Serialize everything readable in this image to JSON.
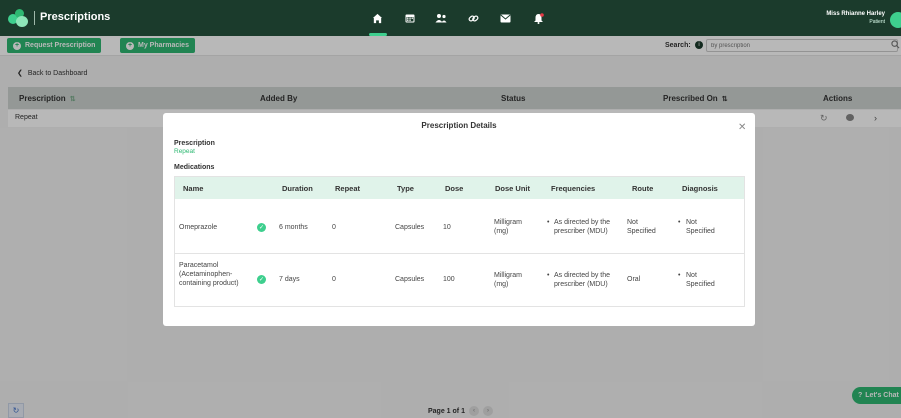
{
  "app": {
    "title": "Prescriptions"
  },
  "user": {
    "name": "Miss Rhianne Harley",
    "role": "Patient"
  },
  "nav": [
    {
      "icon": "home-icon",
      "glyph": "⌂",
      "active": true
    },
    {
      "icon": "calendar-icon",
      "glyph": "▦",
      "active": false
    },
    {
      "icon": "people-icon",
      "glyph": "⚇",
      "active": false
    },
    {
      "icon": "link-icon",
      "glyph": "∞",
      "active": false
    },
    {
      "icon": "mail-icon",
      "glyph": "✉",
      "active": false
    },
    {
      "icon": "bell-icon",
      "glyph": "🔔",
      "active": false,
      "badge_color": "#e63946"
    }
  ],
  "toolbar": {
    "request_label": "Request Prescription",
    "pharmacies_label": "My Pharmacies",
    "search_label": "Search:",
    "search_placeholder": "by prescription"
  },
  "back_label": "Back to Dashboard",
  "table": {
    "headers": [
      "Prescription",
      "Added By",
      "Status",
      "Prescribed On",
      "Actions"
    ],
    "rows": [
      {
        "prescription": "Repeat"
      }
    ]
  },
  "pagination": {
    "label": "Page 1 of 1"
  },
  "chat": {
    "label": "Let's Chat"
  },
  "modal": {
    "title": "Prescription Details",
    "prescription_label": "Prescription",
    "prescription_value": "Repeat",
    "medications_label": "Medications",
    "columns": [
      "Name",
      "Duration",
      "Repeat",
      "Type",
      "Dose",
      "Dose Unit",
      "Frequencies",
      "Route",
      "Diagnosis"
    ],
    "medications": [
      {
        "name": "Omeprazole",
        "duration": "6 months",
        "repeat": "0",
        "type": "Capsules",
        "dose": "10",
        "dose_unit": "Milligram (mg)",
        "frequency": "As directed by the prescriber (MDU)",
        "route": "Not Specified",
        "diagnosis": "Not Specified"
      },
      {
        "name": "Paracetamol (Acetaminophen-containing product)",
        "duration": "7 days",
        "repeat": "0",
        "type": "Capsules",
        "dose": "100",
        "dose_unit": "Milligram (mg)",
        "frequency": "As directed by the prescriber (MDU)",
        "route": "Oral",
        "diagnosis": "Not Specified"
      }
    ]
  },
  "colors": {
    "brand_dark": "#1b3b2c",
    "accent": "#2eb872"
  }
}
